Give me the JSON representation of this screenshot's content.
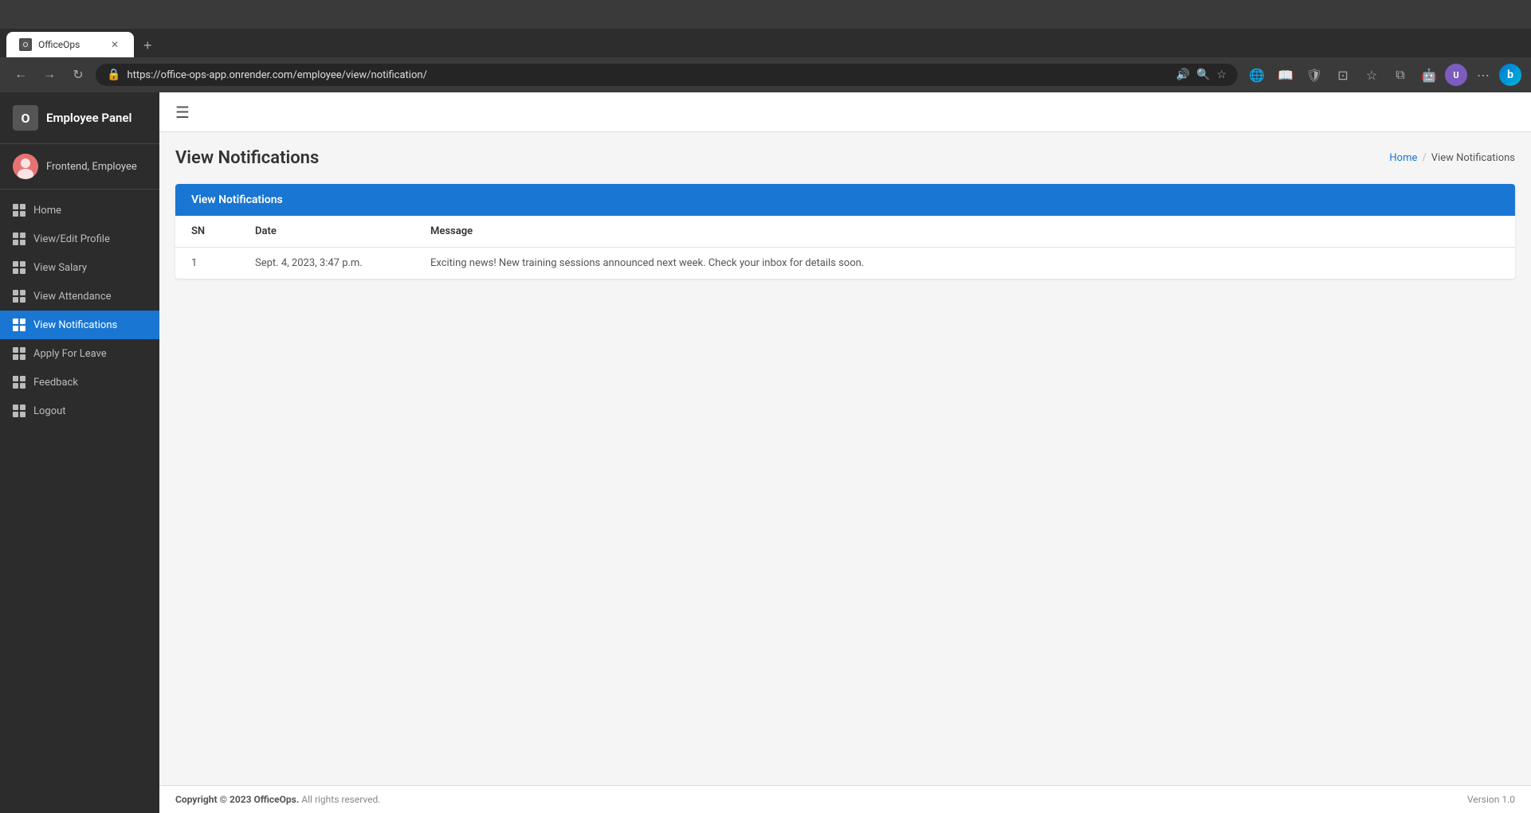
{
  "browser": {
    "tab_title": "OfficeOps",
    "tab_icon": "O",
    "url": "https://office-ops-app.onrender.com/employee/view/notification/",
    "new_tab_label": "+"
  },
  "sidebar": {
    "title": "Employee Panel",
    "logo_letter": "O",
    "user_name": "Frontend, Employee",
    "nav_items": [
      {
        "id": "home",
        "label": "Home",
        "active": false
      },
      {
        "id": "view-edit-profile",
        "label": "View/Edit Profile",
        "active": false
      },
      {
        "id": "view-salary",
        "label": "View Salary",
        "active": false
      },
      {
        "id": "view-attendance",
        "label": "View Attendance",
        "active": false
      },
      {
        "id": "view-notifications",
        "label": "View Notifications",
        "active": true
      },
      {
        "id": "apply-for-leave",
        "label": "Apply For Leave",
        "active": false
      },
      {
        "id": "feedback",
        "label": "Feedback",
        "active": false
      },
      {
        "id": "logout",
        "label": "Logout",
        "active": false
      }
    ]
  },
  "page": {
    "title": "View Notifications",
    "breadcrumb_home": "Home",
    "breadcrumb_current": "View Notifications"
  },
  "card": {
    "header_title": "View Notifications"
  },
  "table": {
    "columns": [
      "SN",
      "Date",
      "Message"
    ],
    "rows": [
      {
        "sn": "1",
        "date": "Sept. 4, 2023, 3:47 p.m.",
        "message": "Exciting news! New training sessions announced next week. Check your inbox for details soon."
      }
    ]
  },
  "footer": {
    "copyright": "Copyright © 2023 OfficeOps.",
    "rights": "All rights reserved.",
    "version": "Version 1.0"
  }
}
